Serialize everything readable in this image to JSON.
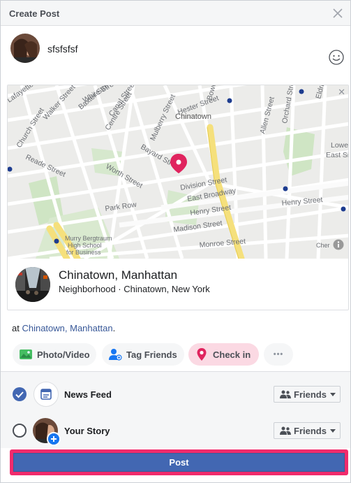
{
  "dialog": {
    "title": "Create Post"
  },
  "composer": {
    "text": "sfsfsfsf"
  },
  "map": {
    "streets": [
      {
        "label": "Lafayette Street"
      },
      {
        "label": "Baxter Street"
      },
      {
        "label": "Canal Street"
      },
      {
        "label": "Walker Street"
      },
      {
        "label": "White Street"
      },
      {
        "label": "Church Street"
      },
      {
        "label": "Centre Street"
      },
      {
        "label": "Mulberry Street"
      },
      {
        "label": "Hester Street"
      },
      {
        "label": "Bowery"
      },
      {
        "label": "Chinatown"
      },
      {
        "label": "Bayard Street"
      },
      {
        "label": "Worth Street"
      },
      {
        "label": "Reade Street"
      },
      {
        "label": "Park Row"
      },
      {
        "label": "Division Street"
      },
      {
        "label": "East Broadway"
      },
      {
        "label": "Henry Street"
      },
      {
        "label": "Madison Street"
      },
      {
        "label": "Monroe Street"
      },
      {
        "label": "Allen Street"
      },
      {
        "label": "Orchard Street"
      },
      {
        "label": "Eldridge"
      },
      {
        "label": "Lowe"
      },
      {
        "label": "East Si"
      },
      {
        "label": "Henry Street"
      },
      {
        "label": "Murry Bergtraum"
      },
      {
        "label": "High School"
      },
      {
        "label": "for Business"
      },
      {
        "label": "Cher"
      }
    ]
  },
  "place": {
    "name": "Chinatown, Manhattan",
    "subtitle": "Neighborhood · Chinatown, New York"
  },
  "at_line": {
    "prefix": "at ",
    "place_link": "Chinatown, Manhattan",
    "suffix": "."
  },
  "actions": {
    "photo_video": "Photo/Video",
    "tag_friends": "Tag Friends",
    "check_in": "Check in",
    "more": "•••"
  },
  "audience": {
    "news_feed": {
      "label": "News Feed",
      "privacy": "Friends",
      "selected": true
    },
    "your_story": {
      "label": "Your Story",
      "privacy": "Friends",
      "selected": false
    }
  },
  "post_button": "Post",
  "colors": {
    "accent": "#4267b2",
    "highlight": "#f02b6c",
    "checkin_bg": "#fbd9e3"
  }
}
